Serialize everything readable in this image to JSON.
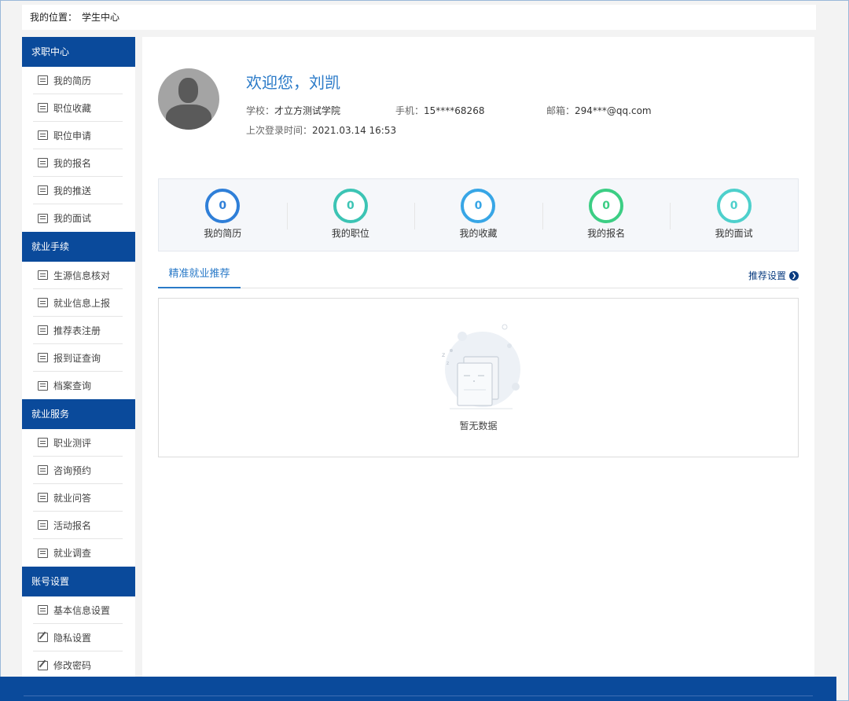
{
  "breadcrumb": {
    "label": "我的位置：",
    "current": "学生中心"
  },
  "sidebar": {
    "sections": [
      {
        "title": "求职中心",
        "items": [
          "我的简历",
          "职位收藏",
          "职位申请",
          "我的报名",
          "我的推送",
          "我的面试"
        ]
      },
      {
        "title": "就业手续",
        "items": [
          "生源信息核对",
          "就业信息上报",
          "推荐表注册",
          "报到证查询",
          "档案查询"
        ]
      },
      {
        "title": "就业服务",
        "items": [
          "职业测评",
          "咨询预约",
          "就业问答",
          "活动报名",
          "就业调查"
        ]
      },
      {
        "title": "账号设置",
        "items": [
          "基本信息设置",
          "隐私设置",
          "修改密码"
        ]
      }
    ]
  },
  "profile": {
    "welcome": "欢迎您，刘凯",
    "school_label": "学校：",
    "school": "才立方测试学院",
    "phone_label": "手机：",
    "phone": "15****68268",
    "email_label": "邮箱：",
    "email": "294***@qq.com",
    "last_login_label": "上次登录时间：",
    "last_login": "2021.03.14 16:53"
  },
  "stats": [
    {
      "label": "我的简历",
      "value": "0",
      "color": "#2f7fd8"
    },
    {
      "label": "我的职位",
      "value": "0",
      "color": "#3cc4b4"
    },
    {
      "label": "我的收藏",
      "value": "0",
      "color": "#38a6e6"
    },
    {
      "label": "我的报名",
      "value": "0",
      "color": "#3cce84"
    },
    {
      "label": "我的面试",
      "value": "0",
      "color": "#4ed0cc"
    }
  ],
  "recommend": {
    "tab": "精准就业推荐",
    "settings": "推荐设置",
    "empty": "暂无数据"
  }
}
